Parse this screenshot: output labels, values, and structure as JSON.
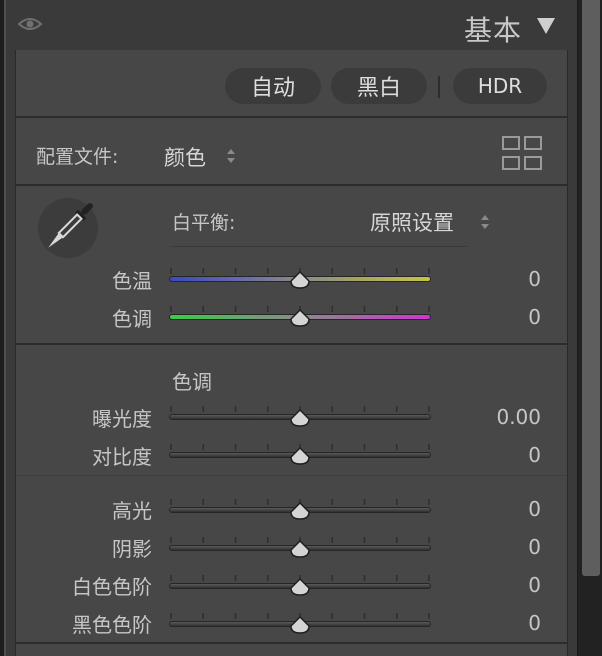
{
  "header": {
    "title": "基本",
    "eye_icon": "eye-icon",
    "collapse_icon": "triangle-down-icon"
  },
  "treatment": {
    "auto_label": "自动",
    "bw_label": "黑白",
    "hdr_label": "HDR"
  },
  "profile": {
    "label": "配置文件:",
    "value": "颜色",
    "browser_icon": "grid-icon"
  },
  "white_balance": {
    "label": "白平衡:",
    "value": "原照设置",
    "eyedropper_icon": "eyedropper-icon",
    "temp": {
      "label": "色温",
      "value": "0"
    },
    "tint": {
      "label": "色调",
      "value": "0"
    }
  },
  "tone": {
    "section_label": "色调",
    "exposure": {
      "label": "曝光度",
      "value": "0.00"
    },
    "contrast": {
      "label": "对比度",
      "value": "0"
    },
    "highlights": {
      "label": "高光",
      "value": "0"
    },
    "shadows": {
      "label": "阴影",
      "value": "0"
    },
    "whites": {
      "label": "白色色阶",
      "value": "0"
    },
    "blacks": {
      "label": "黑色色阶",
      "value": "0"
    }
  },
  "colors": {
    "temp_track_start": "#3b47c9",
    "temp_track_end": "#c9c43b",
    "tint_track_start": "#3ec94b",
    "tint_track_end": "#c63bc9"
  }
}
